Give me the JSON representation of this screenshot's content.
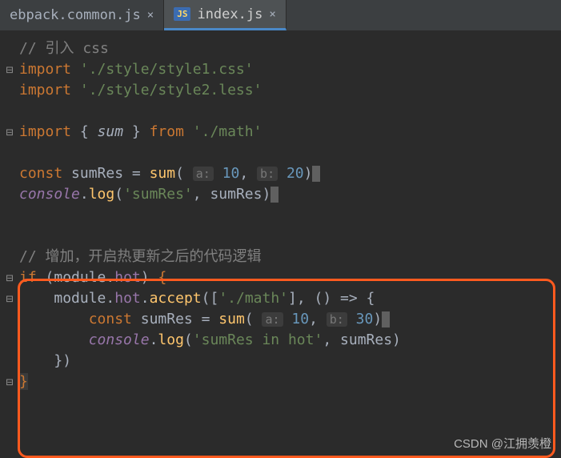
{
  "tabs": [
    {
      "label": "ebpack.common.js",
      "active": false
    },
    {
      "label": "index.js",
      "active": true
    }
  ],
  "jsBadge": "JS",
  "closeGlyph": "×",
  "code": {
    "l1_comment": "// 引入 css",
    "l2_kw": "import ",
    "l2_str": "'./style/style1.css'",
    "l3_kw": "import ",
    "l3_str": "'./style/style2.less'",
    "l5_kw1": "import ",
    "l5_brace_open": "{ ",
    "l5_sum": "sum",
    "l5_brace_close": " } ",
    "l5_from": "from ",
    "l5_str": "'./math'",
    "l7_const": "const ",
    "l7_var": "sumRes ",
    "l7_eq": "= ",
    "l7_fn": "sum",
    "l7_paren_open": "( ",
    "l7_hint_a": "a:",
    "l7_a": " 10",
    "l7_comma": ", ",
    "l7_hint_b": "b:",
    "l7_b": " 20",
    "l7_paren_close": ")",
    "l8_console": "console",
    "l8_dot": ".",
    "l8_log": "log",
    "l8_open": "(",
    "l8_str": "'sumRes'",
    "l8_comma": ", ",
    "l8_arg": "sumRes",
    "l8_close": ")",
    "l10_comment": "// 增加，开启热更新之后的代码逻辑",
    "l11_if": "if ",
    "l11_open": "(",
    "l11_module": "module",
    "l11_dot": ".",
    "l11_hot": "hot",
    "l11_close": ") ",
    "l11_brace": "{",
    "l12_indent": "    ",
    "l12_module": "module",
    "l12_dot1": ".",
    "l12_hot": "hot",
    "l12_dot2": ".",
    "l12_accept": "accept",
    "l12_open": "([",
    "l12_str": "'./math'",
    "l12_mid": "], () => {",
    "l13_indent": "        ",
    "l13_const": "const ",
    "l13_var": "sumRes ",
    "l13_eq": "= ",
    "l13_fn": "sum",
    "l13_open": "( ",
    "l13_hint_a": "a:",
    "l13_a": " 10",
    "l13_comma": ", ",
    "l13_hint_b": "b:",
    "l13_b": " 30",
    "l13_close": ")",
    "l14_indent": "        ",
    "l14_console": "console",
    "l14_dot": ".",
    "l14_log": "log",
    "l14_open": "(",
    "l14_str": "'sumRes in hot'",
    "l14_comma": ", ",
    "l14_arg": "sumRes",
    "l14_close": ")",
    "l15_indent": "    ",
    "l15_close": "})",
    "l16_brace": "}"
  },
  "watermark": "CSDN @江拥羡橙"
}
